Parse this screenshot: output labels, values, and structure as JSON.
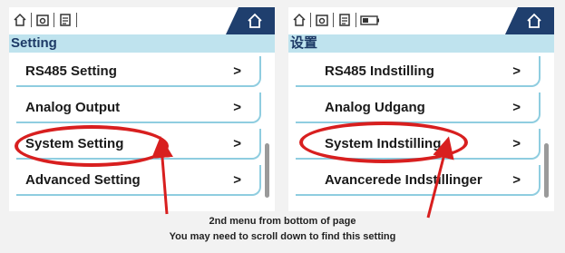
{
  "colors": {
    "accent_dark": "#1f3f6e",
    "title_bar_bg": "#bfe3ee",
    "item_border": "#8fcde0",
    "highlight_red": "#d81f1f"
  },
  "icons": {
    "status": [
      "home-outline-icon",
      "camera-icon",
      "document-icon"
    ],
    "right_extra_status": "battery-icon",
    "tab": "home-icon"
  },
  "left_screen": {
    "title": "Setting",
    "items": [
      {
        "label": "RS485 Setting",
        "chevron": ">"
      },
      {
        "label": "Analog Output",
        "chevron": ">"
      },
      {
        "label": "System Setting",
        "chevron": ">"
      },
      {
        "label": "Advanced Setting",
        "chevron": ">"
      }
    ]
  },
  "right_screen": {
    "title": "设置",
    "items": [
      {
        "label": "RS485 Indstilling",
        "chevron": ">"
      },
      {
        "label": "Analog Udgang",
        "chevron": ">"
      },
      {
        "label": "System Indstilling",
        "chevron": ">"
      },
      {
        "label": "Avancerede Indstillinger",
        "chevron": ">"
      }
    ]
  },
  "annotation": {
    "line1": "2nd menu from bottom of page",
    "line2": "You may need to scroll down to find this setting"
  }
}
